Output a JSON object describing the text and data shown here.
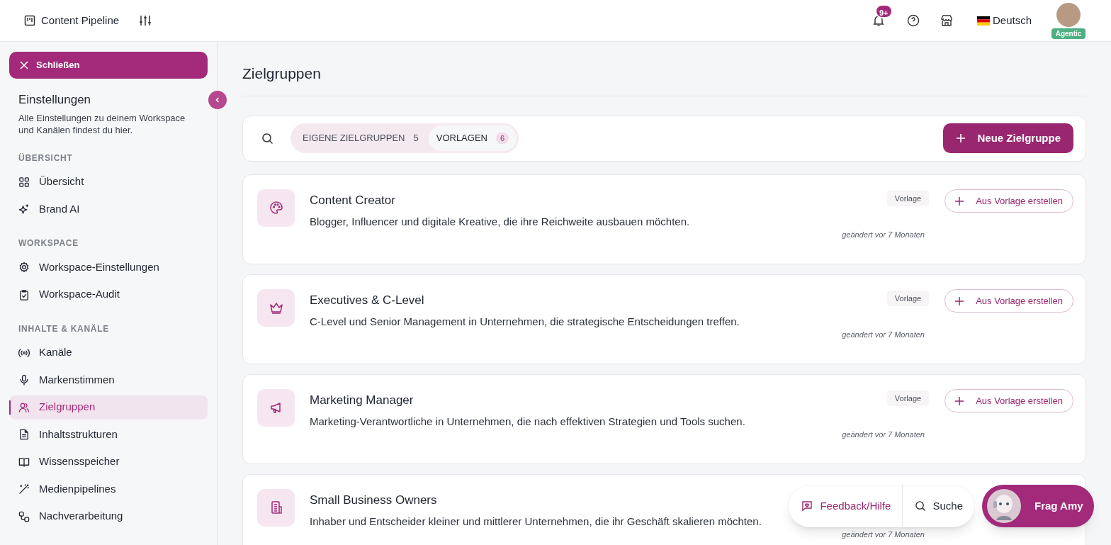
{
  "header": {
    "title": "Content Pipeline",
    "notifications_badge": "9+",
    "language": "Deutsch",
    "user_badge": "Agentic"
  },
  "sidebar": {
    "close_button": "Schließen",
    "title": "Einstellungen",
    "description": "Alle Einstellungen zu deinem Workspace und Kanälen findest du hier.",
    "sections": [
      {
        "heading": "ÜBERSICHT",
        "items": [
          {
            "label": "Übersicht",
            "selected": false
          },
          {
            "label": "Brand AI",
            "selected": false
          }
        ]
      },
      {
        "heading": "WORKSPACE",
        "items": [
          {
            "label": "Workspace-Einstellungen",
            "selected": false
          },
          {
            "label": "Workspace-Audit",
            "selected": false
          }
        ]
      },
      {
        "heading": "INHALTE & KANÄLE",
        "items": [
          {
            "label": "Kanäle",
            "selected": false
          },
          {
            "label": "Markenstimmen",
            "selected": false
          },
          {
            "label": "Zielgruppen",
            "selected": true
          },
          {
            "label": "Inhaltsstrukturen",
            "selected": false
          },
          {
            "label": "Wissensspeicher",
            "selected": false
          },
          {
            "label": "Medienpipelines",
            "selected": false
          },
          {
            "label": "Nachverarbeitung",
            "selected": false
          }
        ]
      }
    ]
  },
  "main": {
    "title": "Zielgruppen",
    "tabs": [
      {
        "label": "EIGENE ZIELGRUPPEN",
        "count": "5",
        "selected": false
      },
      {
        "label": "VORLAGEN",
        "count": "6",
        "selected": true
      }
    ],
    "new_button": "Neue Zielgruppe",
    "cards": [
      {
        "title": "Content Creator",
        "description": "Blogger, Influencer und digitale Kreative, die ihre Reichweite ausbauen möchten.",
        "badge": "Vorlage",
        "button": "Aus Vorlage erstellen",
        "changed": "geändert vor 7 Monaten"
      },
      {
        "title": "Executives & C-Level",
        "description": "C-Level und Senior Management in Unternehmen, die strategische Entscheidungen treffen.",
        "badge": "Vorlage",
        "button": "Aus Vorlage erstellen",
        "changed": "geändert vor 7 Monaten"
      },
      {
        "title": "Marketing Manager",
        "description": "Marketing-Verantwortliche in Unternehmen, die nach effektiven Strategien und Tools suchen.",
        "badge": "Vorlage",
        "button": "Aus Vorlage erstellen",
        "changed": "geändert vor 7 Monaten"
      },
      {
        "title": "Small Business Owners",
        "description": "Inhaber und Entscheider kleiner und mittlerer Unternehmen, die ihr Geschäft skalieren möchten.",
        "changed": "geändert vor 7 Monaten"
      }
    ]
  },
  "floating": {
    "feedback": "Feedback/Hilfe",
    "search": "Suche",
    "assistant": "Frag Amy"
  }
}
